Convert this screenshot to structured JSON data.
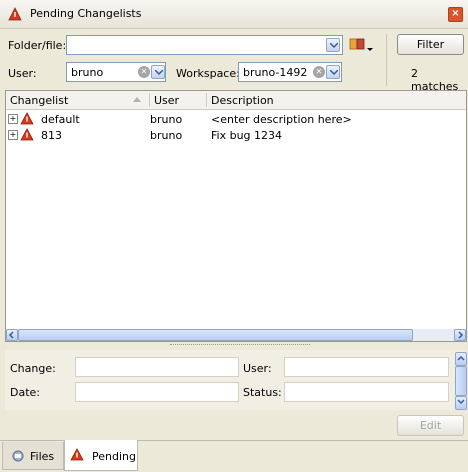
{
  "window": {
    "title": "Pending Changelists"
  },
  "filters": {
    "folder_label": "Folder/file:",
    "folder_value": "",
    "user_label": "User:",
    "user_value": "bruno",
    "workspace_label": "Workspace:",
    "workspace_value": "bruno-1492",
    "filter_button": "Filter",
    "matches": "2 matches"
  },
  "table": {
    "columns": [
      "Changelist",
      "User",
      "Description"
    ],
    "rows": [
      {
        "changelist": "default",
        "user": "bruno",
        "description": "<enter description here>"
      },
      {
        "changelist": "813",
        "user": "bruno",
        "description": "Fix bug 1234"
      }
    ]
  },
  "details": {
    "change_label": "Change:",
    "date_label": "Date:",
    "user_label": "User:",
    "status_label": "Status:",
    "change_value": "",
    "date_value": "",
    "user_value": "",
    "status_value": "",
    "edit_button": "Edit"
  },
  "tabs": [
    {
      "label": "Files",
      "icon": "files-icon"
    },
    {
      "label": "Pending",
      "icon": "pending-icon"
    }
  ],
  "colors": {
    "pending_icon": "#d63a1a",
    "close": "#d9542c"
  }
}
